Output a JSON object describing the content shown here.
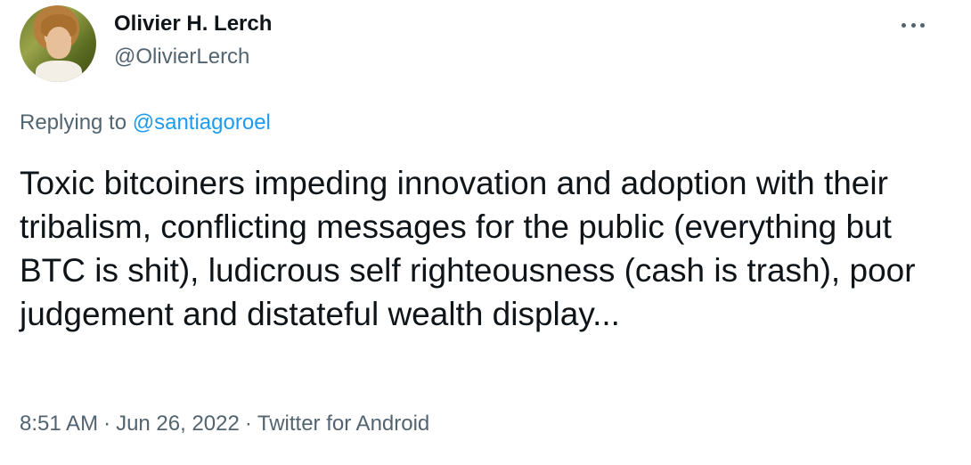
{
  "author": {
    "name": "Olivier H. Lerch",
    "handle": "@OlivierLerch"
  },
  "reply": {
    "prefix": "Replying to",
    "mention": "@santiagoroel"
  },
  "tweet": {
    "text": "Toxic bitcoiners impeding innovation and adoption with their tribalism, conflicting messages for the public (everything but BTC is shit), ludicrous self righteousness (cash is trash), poor judgement and distateful wealth display..."
  },
  "meta": {
    "time": "8:51 AM",
    "separator": "·",
    "date": "Jun 26, 2022",
    "source": "Twitter for Android"
  },
  "icons": {
    "more": "more-horizontal-icon"
  },
  "colors": {
    "text_primary": "#0f1419",
    "text_secondary": "#536471",
    "link": "#1d9bf0"
  }
}
